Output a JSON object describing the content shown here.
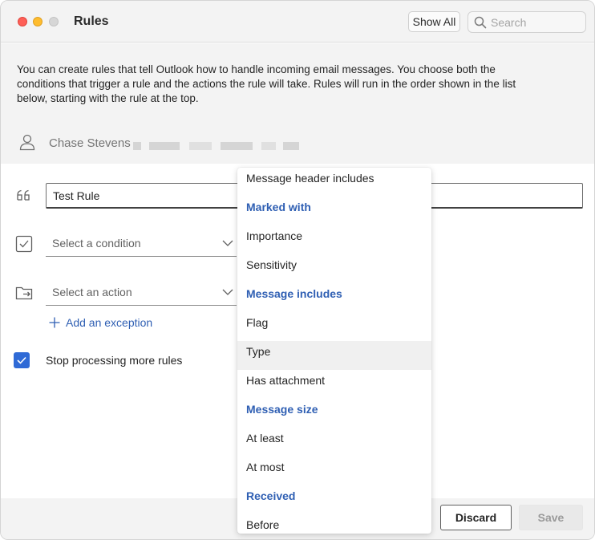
{
  "window": {
    "title": "Rules",
    "show_all_label": "Show All",
    "search_placeholder": "Search"
  },
  "info": {
    "description": "You can create rules that tell Outlook how to handle incoming email messages. You choose both the conditions that trigger a rule and the actions the rule will take. Rules will run in the order shown in the list below, starting with the rule at the top.",
    "account_name": "Chase Stevens"
  },
  "form": {
    "rule_name_value": "Test Rule",
    "condition_placeholder": "Select a condition",
    "action_placeholder": "Select an action",
    "add_exception_label": "Add an exception",
    "stop_processing_label": "Stop processing more rules",
    "stop_processing_checked": true
  },
  "footer": {
    "discard_label": "Discard",
    "save_label": "Save"
  },
  "dropdown": {
    "items": [
      {
        "label": "Message header includes",
        "type": "item"
      },
      {
        "label": "Marked with",
        "type": "header"
      },
      {
        "label": "Importance",
        "type": "item"
      },
      {
        "label": "Sensitivity",
        "type": "item"
      },
      {
        "label": "Message includes",
        "type": "header"
      },
      {
        "label": "Flag",
        "type": "item"
      },
      {
        "label": "Type",
        "type": "item",
        "hovered": true
      },
      {
        "label": "Has attachment",
        "type": "item"
      },
      {
        "label": "Message size",
        "type": "header"
      },
      {
        "label": "At least",
        "type": "item"
      },
      {
        "label": "At most",
        "type": "item"
      },
      {
        "label": "Received",
        "type": "header"
      },
      {
        "label": "Before",
        "type": "item"
      }
    ]
  },
  "colors": {
    "accent": "#2f6ad6",
    "link": "#2f5fb3",
    "panel_gray": "#f3f3f3"
  }
}
